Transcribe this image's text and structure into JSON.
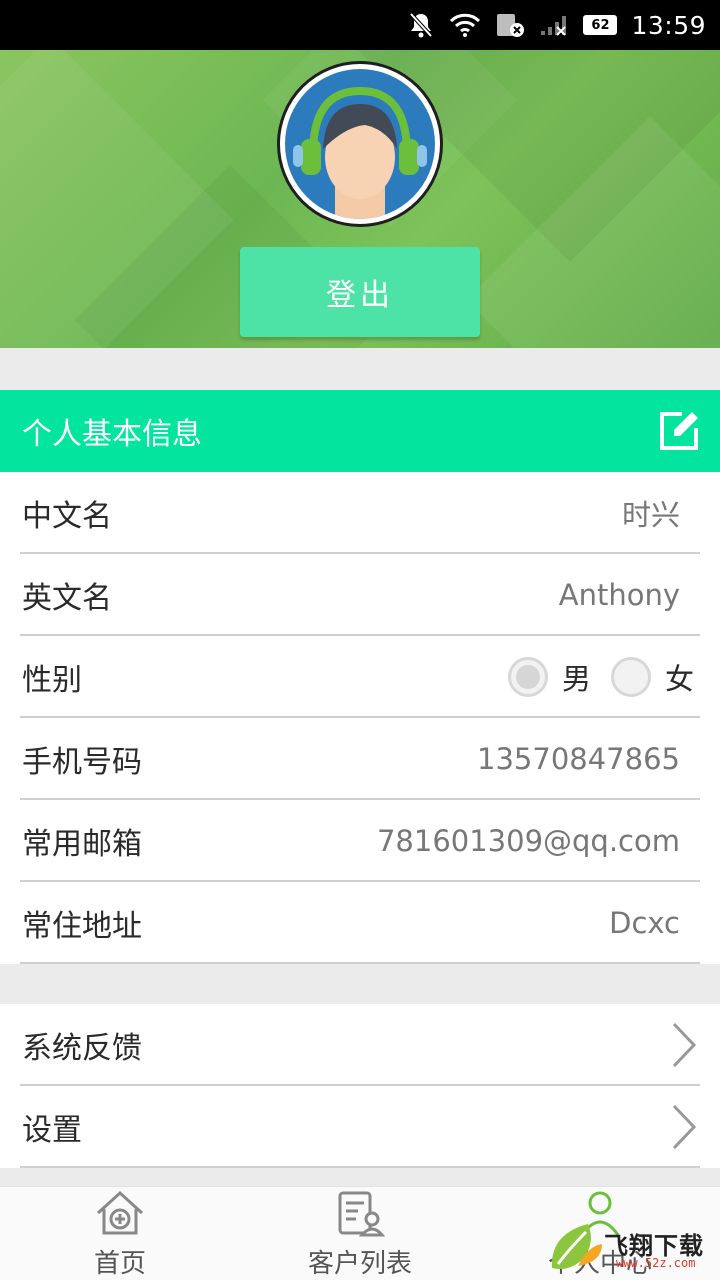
{
  "status_bar": {
    "time": "13:59",
    "battery": "62"
  },
  "header": {
    "logout_label": "登出"
  },
  "profile": {
    "section_title": "个人基本信息",
    "fields": [
      {
        "label": "中文名",
        "value": "时兴"
      },
      {
        "label": "英文名",
        "value": "Anthony"
      },
      {
        "label": "性别",
        "options": [
          "男",
          "女"
        ],
        "selected": "男"
      },
      {
        "label": "手机号码",
        "value": "13570847865"
      },
      {
        "label": "常用邮箱",
        "value": "781601309@qq.com"
      },
      {
        "label": "常住地址",
        "value": "Dcxc"
      }
    ]
  },
  "menu": {
    "items": [
      {
        "label": "系统反馈"
      },
      {
        "label": "设置"
      }
    ]
  },
  "bottom_nav": {
    "items": [
      {
        "label": "首页",
        "icon": "home-add-icon"
      },
      {
        "label": "客户列表",
        "icon": "customer-list-icon"
      },
      {
        "label": "个人中心",
        "icon": "person-icon"
      }
    ]
  },
  "watermark": {
    "text": "飞翔下载",
    "url": "www.52z.com"
  },
  "colors": {
    "header_green": "#6cb752",
    "accent": "#03e49f",
    "logout": "#4ee3a6",
    "status_bar": "#000000"
  }
}
